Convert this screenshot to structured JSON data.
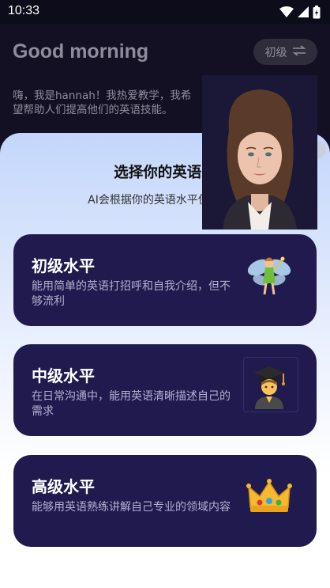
{
  "status_bar": {
    "time": "10:33",
    "icons": [
      "wifi-icon",
      "cellular-signal-icon",
      "battery-icon"
    ]
  },
  "background": {
    "greeting": "Good morning",
    "level_chip": {
      "label": "初级",
      "icon": "swap-arrows-icon"
    },
    "intro_text": "嗨，我是hannah！我热爱教学，我希望帮助人们提高他们的英语技能。"
  },
  "sheet": {
    "title": "选择你的英语水",
    "subtitle": "AI会根据你的英语水平使用合适",
    "levels": [
      {
        "title": "初级水平",
        "description": "能用简单的英语打招呼和自我介绍，但不够流利",
        "icon": "fairy-icon"
      },
      {
        "title": "中级水平",
        "description": "在日常沟通中，能用英语清晰描述自己的需求",
        "icon": "graduate-student-icon"
      },
      {
        "title": "高级水平",
        "description": "能够用英语熟练讲解自己专业的领域内容",
        "icon": "crown-icon"
      }
    ]
  },
  "colors": {
    "card_background": "#201a4e",
    "sheet_gradient_top": "#c3d6fb",
    "app_background": "#121022"
  }
}
